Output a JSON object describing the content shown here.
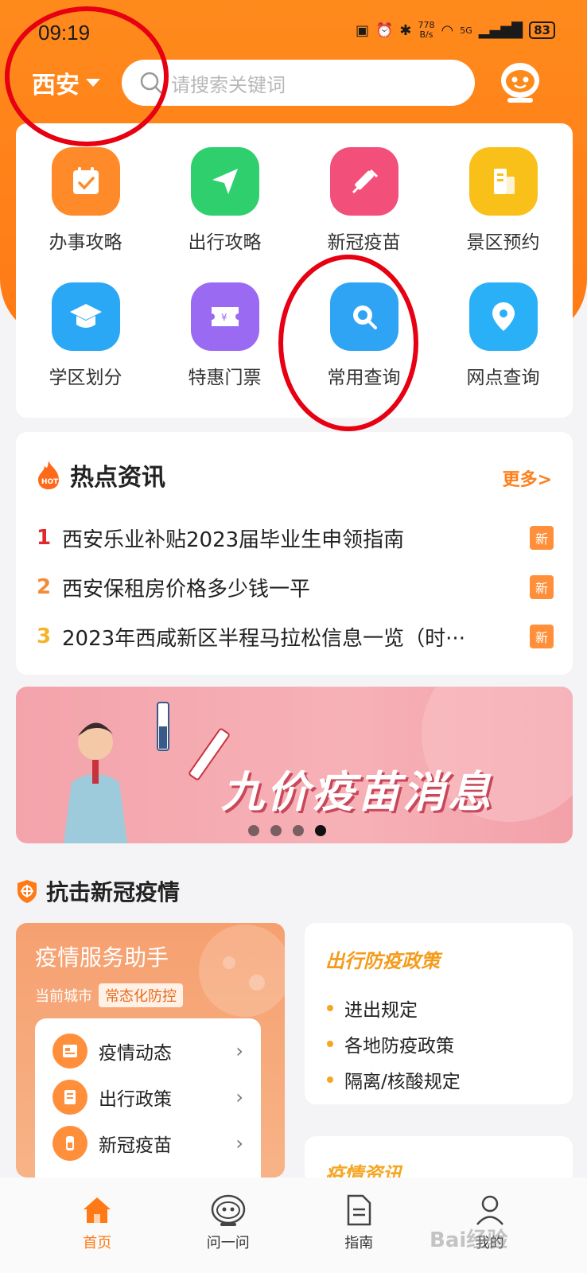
{
  "status_bar": {
    "time": "09:19",
    "net_speed_value": "778",
    "net_speed_unit": "B/s",
    "signal": "5G",
    "battery": "83"
  },
  "header": {
    "city": "西安",
    "search_placeholder": "请搜索关键词"
  },
  "services": [
    {
      "label": "办事攻略",
      "icon": "calendar-check-icon",
      "color": "#ff8a2a"
    },
    {
      "label": "出行攻略",
      "icon": "paper-plane-icon",
      "color": "#2fcf6e"
    },
    {
      "label": "新冠疫苗",
      "icon": "syringe-icon",
      "color": "#f24f7a"
    },
    {
      "label": "景区预约",
      "icon": "building-icon",
      "color": "#f9c01a"
    },
    {
      "label": "学区划分",
      "icon": "graduation-cap-icon",
      "color": "#2aa8f5"
    },
    {
      "label": "特惠门票",
      "icon": "ticket-icon",
      "color": "#9a6bf2"
    },
    {
      "label": "常用查询",
      "icon": "search-icon",
      "color": "#2fa4f4"
    },
    {
      "label": "网点查询",
      "icon": "location-pin-icon",
      "color": "#2ab0f6"
    }
  ],
  "hot_news": {
    "title": "热点资讯",
    "hot_badge": "HOT",
    "more": "更多>",
    "new_badge": "新",
    "items": [
      {
        "rank": "1",
        "text": "西安乐业补贴2023届毕业生申领指南",
        "rank_color": "#e0282e"
      },
      {
        "rank": "2",
        "text": "西安保租房价格多少钱一平",
        "rank_color": "#f08c3a"
      },
      {
        "rank": "3",
        "text": "2023年西咸新区半程马拉松信息一览（时···",
        "rank_color": "#f5b32a"
      }
    ]
  },
  "banner": {
    "title": "九价疫苗消息",
    "slide_count": 4,
    "active_slide": 4
  },
  "covid_section": {
    "title": "抗击新冠疫情",
    "assistant": {
      "title": "疫情服务助手",
      "city_label": "当前城市",
      "city_status": "常态化防控",
      "rows": [
        "疫情动态",
        "出行政策",
        "新冠疫苗"
      ]
    },
    "policy": {
      "title": "出行防疫政策",
      "items": [
        "进出规定",
        "各地防疫政策",
        "隔离/核酸规定"
      ]
    },
    "info_title": "疫情资讯"
  },
  "tabbar": {
    "tabs": [
      {
        "label": "首页",
        "icon": "home-icon",
        "active": true
      },
      {
        "label": "问一问",
        "icon": "robot-icon",
        "active": false
      },
      {
        "label": "指南",
        "icon": "document-icon",
        "active": false
      },
      {
        "label": "我的",
        "icon": "user-icon",
        "active": false
      }
    ]
  },
  "watermark": "Bai经验",
  "colors": {
    "brand": "#ff7a16",
    "annotation": "#e60012"
  }
}
